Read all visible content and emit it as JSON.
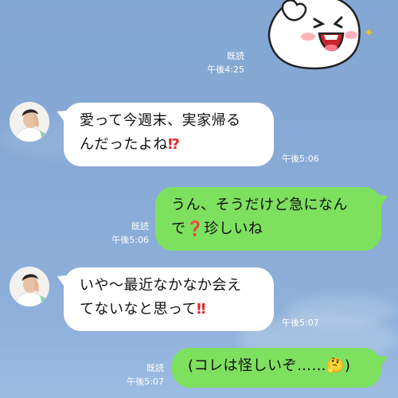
{
  "theme": {
    "bubble_incoming": "#ffffff",
    "bubble_outgoing": "#7ee05f",
    "meta_text": "#ffffff",
    "emphasis_red": "#e0252b"
  },
  "sticker": {
    "name": "brown-style-sticker-face-icon",
    "sparkle": "✦"
  },
  "messages": [
    {
      "id": "m0",
      "side": "right",
      "type": "sticker",
      "read": "既読",
      "time": "午後4:25"
    },
    {
      "id": "m1",
      "side": "left",
      "avatar": "avatar-man-icon",
      "lines": [
        "愛って今週末、実家帰る",
        "んだったよね"
      ],
      "emoji": "⁉",
      "time": "午後5:06"
    },
    {
      "id": "m2",
      "side": "right",
      "lines": [
        "うん、そうだけど急になん",
        "で",
        "珍しいね"
      ],
      "emoji": "❓",
      "read": "既読",
      "time": "午後5:06"
    },
    {
      "id": "m3",
      "side": "left",
      "avatar": "avatar-man-icon",
      "lines": [
        "いや〜最近なかなか会え",
        "てないなと思って"
      ],
      "emoji": "‼",
      "time": "午後5:07"
    },
    {
      "id": "m4",
      "side": "right",
      "lines": [
        "(コレは怪しいぞ……"
      ],
      "emoji": "🤔",
      "closing": ")",
      "read": "既読",
      "time": "午後5:07"
    }
  ]
}
